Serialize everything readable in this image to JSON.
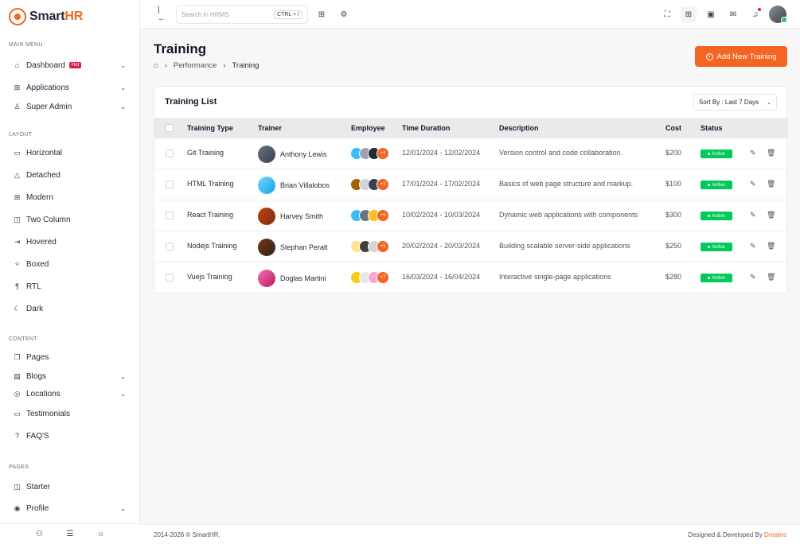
{
  "app": {
    "logo_text": "Smart",
    "logo_text_accent": "HR"
  },
  "sidebar": {
    "sections": [
      {
        "label": "MAIN MENU"
      },
      {
        "label": "LAYOUT"
      },
      {
        "label": "CONTENT"
      },
      {
        "label": "PAGES"
      }
    ],
    "items": [
      {
        "label": "Dashboard",
        "icon": "home-icon",
        "badge": "Hot",
        "chevron": true
      },
      {
        "label": "Applications",
        "icon": "grid-icon",
        "chevron": true
      },
      {
        "label": "Super Admin",
        "icon": "user-cog-icon",
        "chevron": true
      },
      {
        "label": "Horizontal",
        "icon": "layout-icon"
      },
      {
        "label": "Detached",
        "icon": "triangle-icon"
      },
      {
        "label": "Modern",
        "icon": "table-icon"
      },
      {
        "label": "Two Column",
        "icon": "columns-icon"
      },
      {
        "label": "Hovered",
        "icon": "pointer-icon"
      },
      {
        "label": "Boxed",
        "icon": "box-icon"
      },
      {
        "label": "RTL",
        "icon": "text-direction-icon"
      },
      {
        "label": "Dark",
        "icon": "moon-icon"
      },
      {
        "label": "Pages",
        "icon": "pages-icon"
      },
      {
        "label": "Blogs",
        "icon": "blog-icon",
        "chevron": true
      },
      {
        "label": "Locations",
        "icon": "location-icon",
        "chevron": true
      },
      {
        "label": "Testimonials",
        "icon": "message-icon"
      },
      {
        "label": "FAQ'S",
        "icon": "question-icon"
      },
      {
        "label": "Starter",
        "icon": "layout-sidebar-icon"
      },
      {
        "label": "Profile",
        "icon": "user-circle-icon",
        "chevron": true
      }
    ]
  },
  "topbar": {
    "search_placeholder": "Search in HRMS",
    "shortcut": "CTRL + /"
  },
  "page": {
    "title": "Training",
    "breadcrumb": [
      "Performance",
      "Training"
    ],
    "add_button": "Add New Training"
  },
  "card": {
    "title": "Training List",
    "sort_label": "Sort By : Last 7 Days"
  },
  "table": {
    "columns": [
      "Training Type",
      "Trainer",
      "Employee",
      "Time Duration",
      "Description",
      "Cost",
      "Status"
    ],
    "rows": [
      {
        "type": "Git Training",
        "trainer": "Anthony Lewis",
        "more": "+4",
        "duration": "12/01/2024 - 12/02/2024",
        "description": "Version control and code collaboration.",
        "cost": "$200",
        "status": "Active"
      },
      {
        "type": "HTML Training",
        "trainer": "Brian Villalobos",
        "more": "+3",
        "duration": "17/01/2024 - 17/02/2024",
        "description": "Basics of web page structure and markup.",
        "cost": "$100",
        "status": "Active"
      },
      {
        "type": "React Training",
        "trainer": "Harvey Smith",
        "more": "+6",
        "duration": "10/02/2024 - 10/03/2024",
        "description": "Dynamic web applications with components",
        "cost": "$300",
        "status": "Active"
      },
      {
        "type": "Nodejs Training",
        "trainer": "Stephan Peralt",
        "more": "+5",
        "duration": "20/02/2024 - 20/03/2024",
        "description": "Building scalable server-side applications",
        "cost": "$250",
        "status": "Active"
      },
      {
        "type": "Vuejs Training",
        "trainer": "Doglas Martini",
        "more": "+7",
        "duration": "16/03/2024 - 16/04/2024",
        "description": "Interactive single-page applications",
        "cost": "$280",
        "status": "Active"
      }
    ]
  },
  "footer": {
    "copyright": "2014-2026 © SmartHR.",
    "designed": "Designed & Developed By",
    "brand": "Dreams"
  },
  "colors": {
    "accent": "#f26522",
    "active": "#03c95a",
    "hot": "#e11d48"
  }
}
